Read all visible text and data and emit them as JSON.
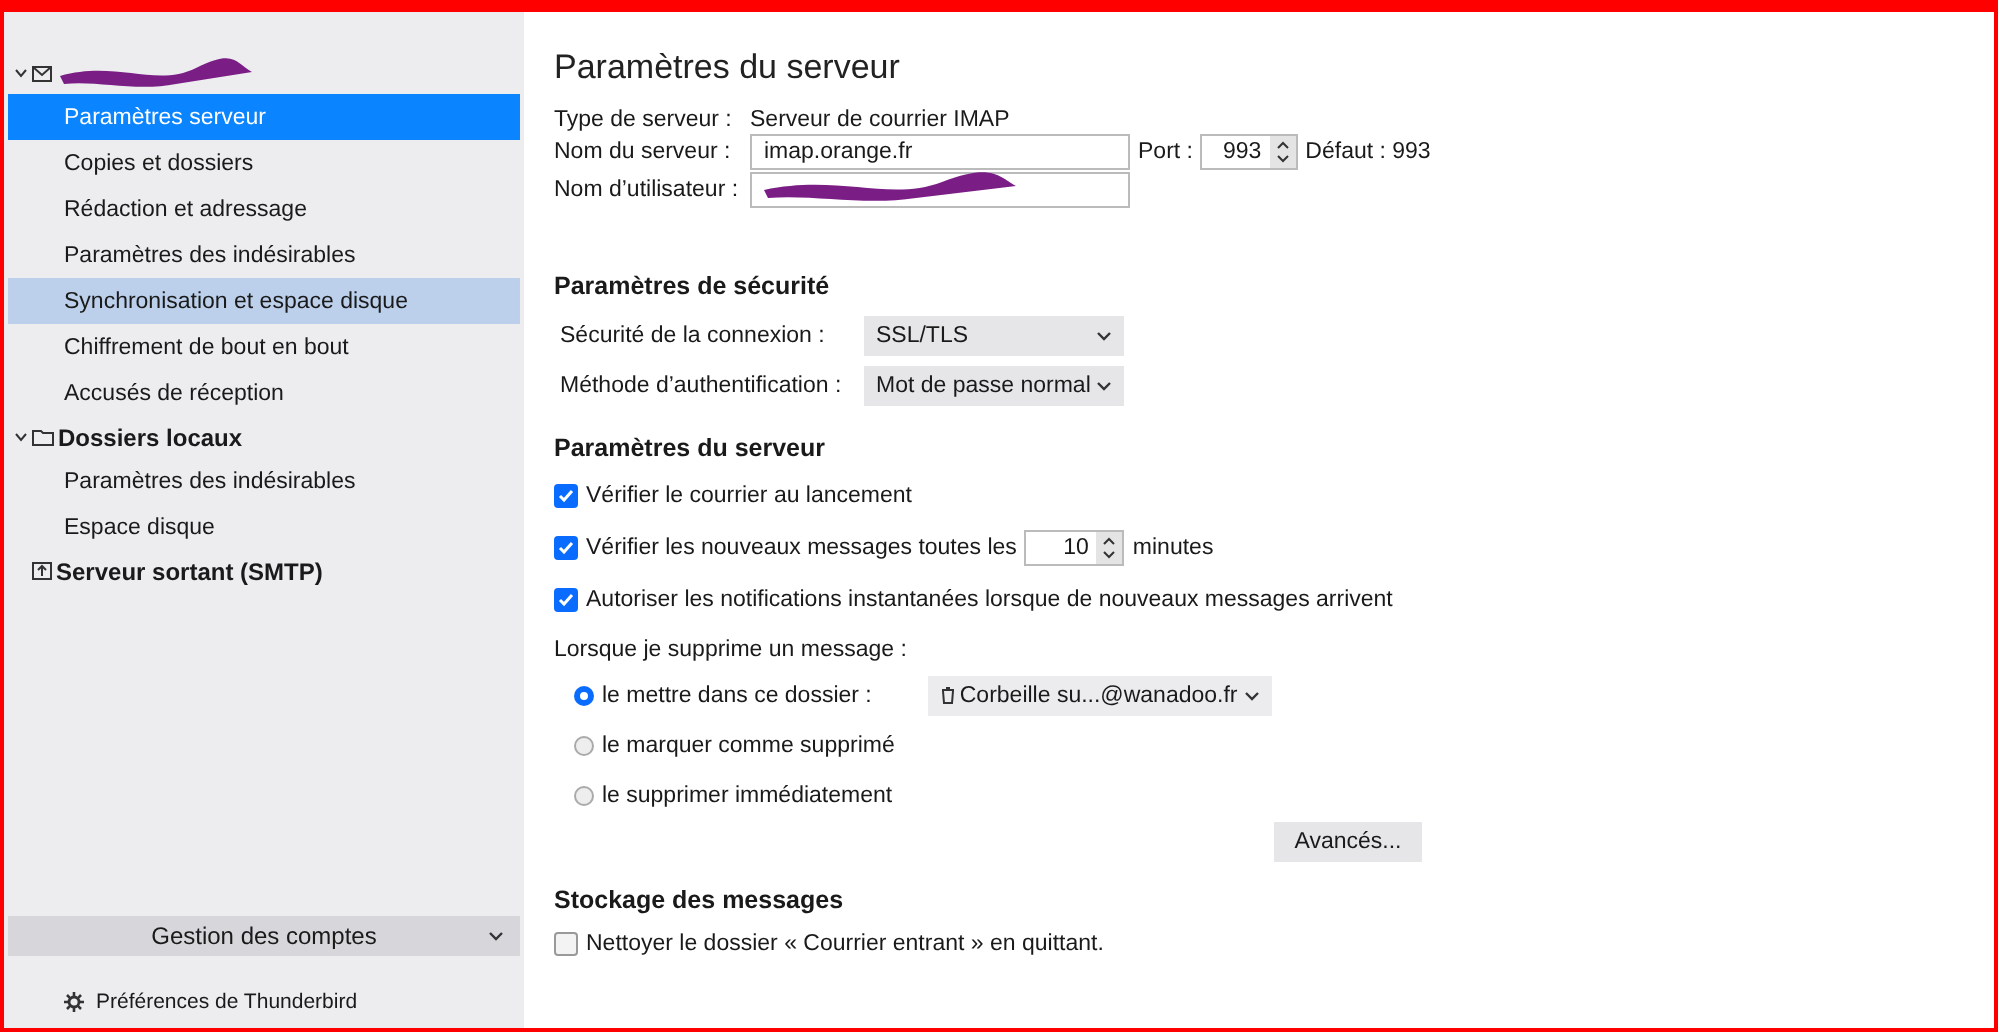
{
  "sidebar": {
    "tree": [
      {
        "kind": "mail",
        "expanded": true,
        "children": [
          {
            "label": "Paramètres serveur",
            "selected": true,
            "hovered": false
          },
          {
            "label": "Copies et dossiers",
            "selected": false,
            "hovered": false
          },
          {
            "label": "Rédaction et adressage",
            "selected": false,
            "hovered": false
          },
          {
            "label": "Paramètres des indésirables",
            "selected": false,
            "hovered": false
          },
          {
            "label": "Synchronisation et espace disque",
            "selected": false,
            "hovered": true
          },
          {
            "label": "Chiffrement de bout en bout",
            "selected": false,
            "hovered": false
          },
          {
            "label": "Accusés de réception",
            "selected": false,
            "hovered": false
          }
        ]
      },
      {
        "kind": "folder",
        "label": "Dossiers locaux",
        "expanded": true,
        "children": [
          {
            "label": "Paramètres des indésirables",
            "selected": false,
            "hovered": false
          },
          {
            "label": "Espace disque",
            "selected": false,
            "hovered": false
          }
        ]
      },
      {
        "kind": "smtp",
        "label": "Serveur sortant (SMTP)"
      }
    ],
    "account_menu": "Gestion des comptes",
    "preferences": "Préférences de Thunderbird"
  },
  "title": "Paramètres du serveur",
  "server": {
    "type_label": "Type de serveur :",
    "type_value": "Serveur de courrier IMAP",
    "name_label": "Nom du serveur :",
    "name_value": "imap.orange.fr",
    "port_label": "Port :",
    "port_value": "993",
    "default_text": "Défaut : 993",
    "user_label": "Nom d’utilisateur :"
  },
  "security": {
    "heading": "Paramètres de sécurité",
    "rows": [
      {
        "label": "Sécurité de la connexion :",
        "value": "SSL/TLS"
      },
      {
        "label": "Méthode d’authentification :",
        "value": "Mot de passe normal"
      }
    ]
  },
  "server_settings": {
    "heading": "Paramètres du serveur",
    "checks": [
      {
        "kind": "plain",
        "label": "Vérifier le courrier au lancement",
        "checked": true
      },
      {
        "kind": "interval",
        "label": "Vérifier les nouveaux messages toutes les",
        "value": "10",
        "suffix": "minutes",
        "checked": true
      },
      {
        "kind": "plain",
        "label": "Autoriser les notifications instantanées lorsque de nouveaux messages arrivent",
        "checked": true
      }
    ],
    "delete_label": "Lorsque je supprime un message :",
    "delete_options": [
      {
        "label": "le mettre dans ce dossier :",
        "selected": true,
        "folder": "Corbeille su...@wanadoo.fr"
      },
      {
        "label": "le marquer comme supprimé",
        "selected": false
      },
      {
        "label": "le supprimer immédiatement",
        "selected": false
      }
    ],
    "advanced": "Avancés..."
  },
  "storage": {
    "heading": "Stockage des messages",
    "checks": [
      {
        "label": "Nettoyer le dossier « Courrier entrant » en quittant.",
        "checked": false
      }
    ]
  }
}
